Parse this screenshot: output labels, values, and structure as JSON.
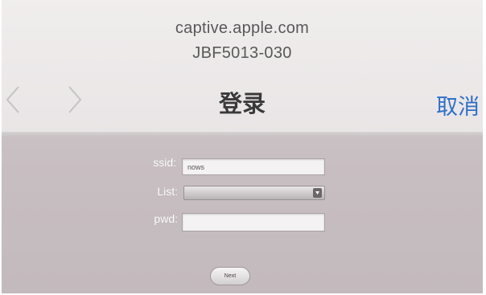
{
  "header": {
    "host": "captive.apple.com",
    "network_name": "JBF5013-030",
    "title": "登录",
    "cancel_label": "取消",
    "back_icon": "chevron-left-icon",
    "forward_icon": "chevron-right-icon",
    "link_color": "#2f6fc6"
  },
  "form": {
    "ssid_label": "ssid:",
    "ssid_value": "nows",
    "list_label": "List:",
    "list_value": "",
    "pwd_label": "pwd:",
    "pwd_value": "",
    "submit_label": "Next"
  }
}
